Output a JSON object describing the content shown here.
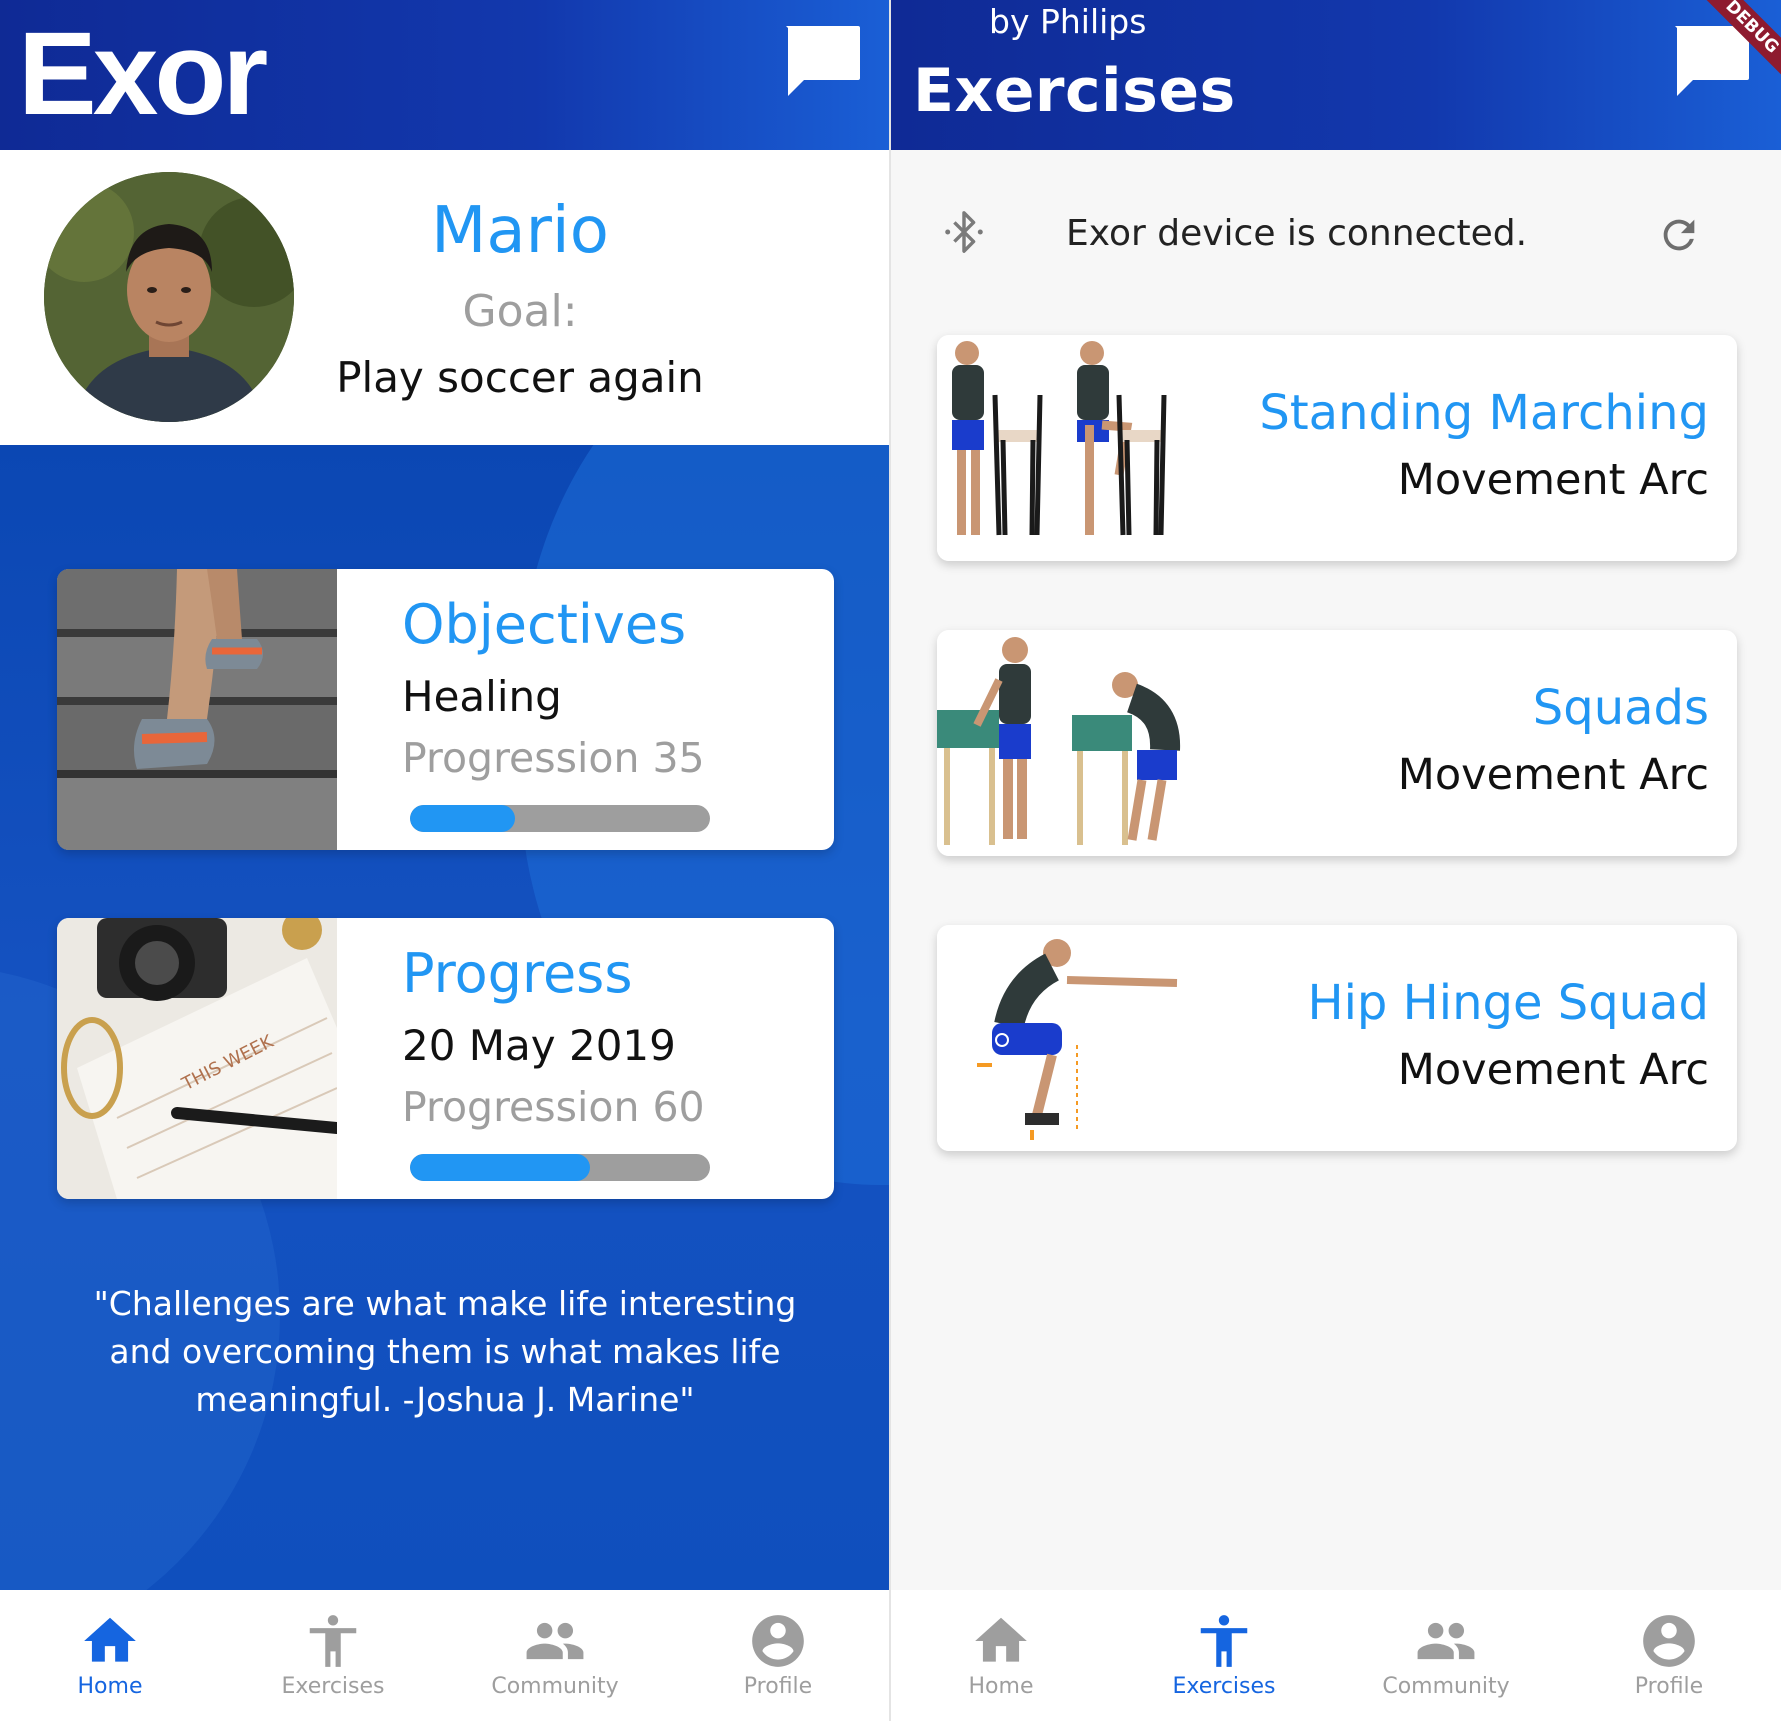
{
  "home_screen": {
    "app_bar": {
      "logo_text": "Exor",
      "chat_icon": "chat-bubble-icon"
    },
    "profile": {
      "name": "Mario",
      "goal_label": "Goal:",
      "goal": "Play soccer again"
    },
    "cards": [
      {
        "title": "Objectives",
        "main": "Healing",
        "progression": "Progression 35",
        "progress_value": 35
      },
      {
        "title": "Progress",
        "main": "20 May 2019",
        "progression": "Progression 60",
        "progress_value": 60
      }
    ],
    "quote": "\"Challenges are what make life interesting and overcoming them is what makes life meaningful. -Joshua J. Marine\"",
    "active_tab": "Home"
  },
  "exercises_screen": {
    "app_bar": {
      "subtitle": "by Philips",
      "title": "Exercises",
      "debug_banner": "DEBUG",
      "chat_icon": "chat-bubble-icon"
    },
    "status": {
      "icon": "bluetooth-icon",
      "text": "Exor device is connected.",
      "refresh_icon": "refresh-icon"
    },
    "exercises": [
      {
        "title": "Standing Marching",
        "subtitle": "Movement Arc"
      },
      {
        "title": "Squads",
        "subtitle": "Movement Arc"
      },
      {
        "title": "Hip Hinge Squad",
        "subtitle": "Movement Arc"
      }
    ],
    "active_tab": "Exercises"
  },
  "nav": {
    "items": [
      {
        "label": "Home",
        "icon": "home-icon"
      },
      {
        "label": "Exercises",
        "icon": "accessibility-icon"
      },
      {
        "label": "Community",
        "icon": "people-icon"
      },
      {
        "label": "Profile",
        "icon": "account-circle-icon"
      }
    ]
  },
  "colors": {
    "accent": "#2196f3",
    "app_bar": "#1238ad",
    "active_nav": "#1565e0",
    "inactive_nav": "#9e9e9e",
    "debug": "#8e1b2f"
  }
}
